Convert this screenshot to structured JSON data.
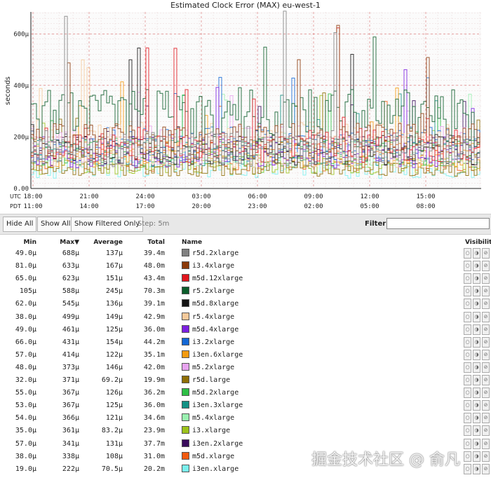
{
  "chart_data": {
    "type": "line",
    "title": "Estimated Clock Error (MAX) eu-west-1",
    "ylabel": "seconds",
    "ylim": [
      0,
      0.000685
    ],
    "y_ticks": [
      "0.00",
      "200µ",
      "400µ",
      "600µ"
    ],
    "x_ticks_utc": [
      "18:00",
      "21:00",
      "24:00",
      "03:00",
      "06:00",
      "09:00",
      "12:00",
      "15:00"
    ],
    "x_ticks_pdt": [
      "11:00",
      "14:00",
      "17:00",
      "20:00",
      "23:00",
      "02:00",
      "05:00",
      "08:00"
    ],
    "x_tz_labels": [
      "UTC",
      "PDT"
    ],
    "grid": true,
    "series": [
      {
        "name": "r5d.2xlarge",
        "color": "#808080",
        "min": 4.9e-05,
        "max": 0.000688,
        "avg": 0.000137
      },
      {
        "name": "i3.4xlarge",
        "color": "#8b3a0a",
        "min": 8.1e-05,
        "max": 0.000633,
        "avg": 0.000167
      },
      {
        "name": "m5d.12xlarge",
        "color": "#e0161d",
        "min": 6.5e-05,
        "max": 0.000623,
        "avg": 0.000151
      },
      {
        "name": "r5.2xlarge",
        "color": "#0b5c2a",
        "min": 0.000105,
        "max": 0.000588,
        "avg": 0.000245
      },
      {
        "name": "m5d.8xlarge",
        "color": "#141414",
        "min": 6.2e-05,
        "max": 0.000545,
        "avg": 0.000136
      },
      {
        "name": "r5.4xlarge",
        "color": "#f5c99a",
        "min": 3.8e-05,
        "max": 0.000499,
        "avg": 0.000149
      },
      {
        "name": "m5d.4xlarge",
        "color": "#7b1fe0",
        "min": 4.9e-05,
        "max": 0.000461,
        "avg": 0.000125
      },
      {
        "name": "i3.2xlarge",
        "color": "#1266d4",
        "min": 6.6e-05,
        "max": 0.000431,
        "avg": 0.000154
      },
      {
        "name": "i3en.6xlarge",
        "color": "#f39a10",
        "min": 5.7e-05,
        "max": 0.000414,
        "avg": 0.000122
      },
      {
        "name": "m5.2xlarge",
        "color": "#e7a3ef",
        "min": 4.8e-05,
        "max": 0.000373,
        "avg": 0.000146
      },
      {
        "name": "r5d.large",
        "color": "#8e6d06",
        "min": 3.2e-05,
        "max": 0.000371,
        "avg": 6.92e-05
      },
      {
        "name": "m5d.2xlarge",
        "color": "#2dbf45",
        "min": 5.5e-05,
        "max": 0.000367,
        "avg": 0.000126
      },
      {
        "name": "i3en.3xlarge",
        "color": "#129184",
        "min": 5.3e-05,
        "max": 0.000367,
        "avg": 0.000125
      },
      {
        "name": "m5.4xlarge",
        "color": "#99f0b0",
        "min": 5.4e-05,
        "max": 0.000366,
        "avg": 0.000121
      },
      {
        "name": "i3.xlarge",
        "color": "#9cc21a",
        "min": 3.5e-05,
        "max": 0.000361,
        "avg": 8.32e-05
      },
      {
        "name": "i3en.2xlarge",
        "color": "#3a0c5c",
        "min": 5.7e-05,
        "max": 0.000341,
        "avg": 0.000131
      },
      {
        "name": "m5d.xlarge",
        "color": "#f25a10",
        "min": 3.8e-05,
        "max": 0.000338,
        "avg": 0.000108
      },
      {
        "name": "i3en.xlarge",
        "color": "#7af0ee",
        "min": 1.9e-05,
        "max": 0.000222,
        "avg": 7.05e-05
      }
    ]
  },
  "toolbar": {
    "hide_all": "Hide All",
    "show_all": "Show All",
    "show_filtered": "Show Filtered Only",
    "step": "Step: 5m",
    "filter_label": "Filter:",
    "filter_value": ""
  },
  "table": {
    "headers": {
      "min": "Min",
      "max": "Max▼",
      "average": "Average",
      "total": "Total",
      "name": "Name",
      "visibility": "Visibility"
    },
    "rows": [
      {
        "min": "49.0µ",
        "max": "688µ",
        "avg": "137µ",
        "total": "39.4m",
        "name": "r5d.2xlarge"
      },
      {
        "min": "81.0µ",
        "max": "633µ",
        "avg": "167µ",
        "total": "48.0m",
        "name": "i3.4xlarge"
      },
      {
        "min": "65.0µ",
        "max": "623µ",
        "avg": "151µ",
        "total": "43.4m",
        "name": "m5d.12xlarge"
      },
      {
        "min": "105µ",
        "max": "588µ",
        "avg": "245µ",
        "total": "70.3m",
        "name": "r5.2xlarge"
      },
      {
        "min": "62.0µ",
        "max": "545µ",
        "avg": "136µ",
        "total": "39.1m",
        "name": "m5d.8xlarge"
      },
      {
        "min": "38.0µ",
        "max": "499µ",
        "avg": "149µ",
        "total": "42.9m",
        "name": "r5.4xlarge"
      },
      {
        "min": "49.0µ",
        "max": "461µ",
        "avg": "125µ",
        "total": "36.0m",
        "name": "m5d.4xlarge"
      },
      {
        "min": "66.0µ",
        "max": "431µ",
        "avg": "154µ",
        "total": "44.2m",
        "name": "i3.2xlarge"
      },
      {
        "min": "57.0µ",
        "max": "414µ",
        "avg": "122µ",
        "total": "35.1m",
        "name": "i3en.6xlarge"
      },
      {
        "min": "48.0µ",
        "max": "373µ",
        "avg": "146µ",
        "total": "42.0m",
        "name": "m5.2xlarge"
      },
      {
        "min": "32.0µ",
        "max": "371µ",
        "avg": "69.2µ",
        "total": "19.9m",
        "name": "r5d.large"
      },
      {
        "min": "55.0µ",
        "max": "367µ",
        "avg": "126µ",
        "total": "36.2m",
        "name": "m5d.2xlarge"
      },
      {
        "min": "53.0µ",
        "max": "367µ",
        "avg": "125µ",
        "total": "36.0m",
        "name": "i3en.3xlarge"
      },
      {
        "min": "54.0µ",
        "max": "366µ",
        "avg": "121µ",
        "total": "34.6m",
        "name": "m5.4xlarge"
      },
      {
        "min": "35.0µ",
        "max": "361µ",
        "avg": "83.2µ",
        "total": "23.9m",
        "name": "i3.xlarge"
      },
      {
        "min": "57.0µ",
        "max": "341µ",
        "avg": "131µ",
        "total": "37.7m",
        "name": "i3en.2xlarge"
      },
      {
        "min": "38.0µ",
        "max": "338µ",
        "avg": "108µ",
        "total": "31.0m",
        "name": "m5d.xlarge"
      },
      {
        "min": "19.0µ",
        "max": "222µ",
        "avg": "70.5µ",
        "total": "20.2m",
        "name": "i3en.xlarge"
      }
    ]
  },
  "watermark": "掘金技术社区 @ 俞凡"
}
